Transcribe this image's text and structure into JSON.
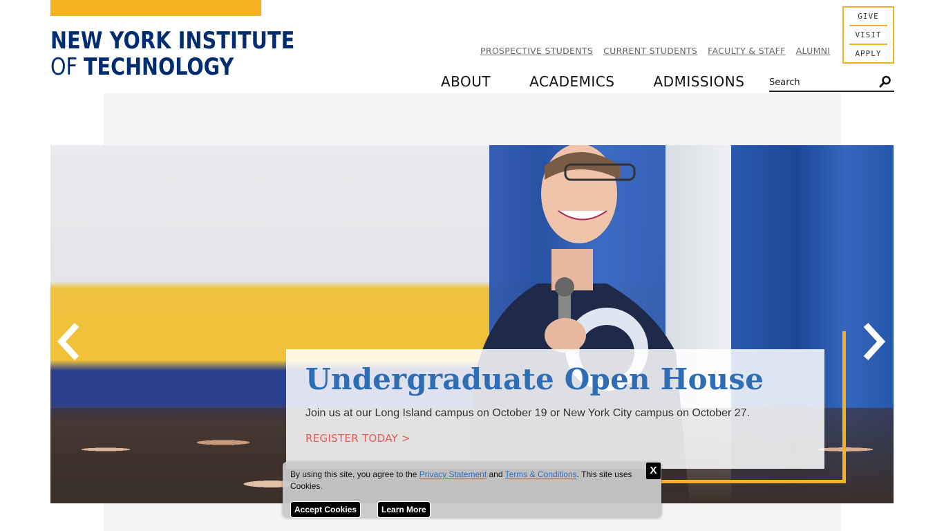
{
  "logo": {
    "line1": "NEW YORK INSTITUTE",
    "line2_of": "OF ",
    "line2_main": "TECHNOLOGY",
    "bar_color": "#f4b223",
    "text_color": "#002d72"
  },
  "utility_nav": [
    {
      "label": "PROSPECTIVE STUDENTS"
    },
    {
      "label": "CURRENT STUDENTS"
    },
    {
      "label": "FACULTY & STAFF"
    },
    {
      "label": "ALUMNI"
    }
  ],
  "cta_links": [
    {
      "label": "GIVE"
    },
    {
      "label": "VISIT"
    },
    {
      "label": "APPLY"
    }
  ],
  "main_nav": [
    {
      "label": "ABOUT"
    },
    {
      "label": "ACADEMICS"
    },
    {
      "label": "ADMISSIONS"
    }
  ],
  "search": {
    "placeholder": "Search",
    "icon": "search-icon"
  },
  "hero": {
    "title": "Undergraduate Open House",
    "text": "Join us at our Long Island campus on October 19 or New York City campus on October 27.",
    "cta": "REGISTER TODAY  >",
    "prev_icon": "chevron-left-icon",
    "next_icon": "chevron-right-icon",
    "accent_color": "#f4b223",
    "title_color": "#2f6db5",
    "cta_color": "#e05a5a"
  },
  "cookie": {
    "text_before": "By using this site, you agree to the ",
    "privacy_link": "Privacy Statement",
    "text_and": " and ",
    "terms_link": "Terms & Conditions",
    "text_after": ". This site uses Cookies.",
    "accept_label": "Accept Cookies",
    "learn_label": "Learn More",
    "close_label": "X"
  }
}
